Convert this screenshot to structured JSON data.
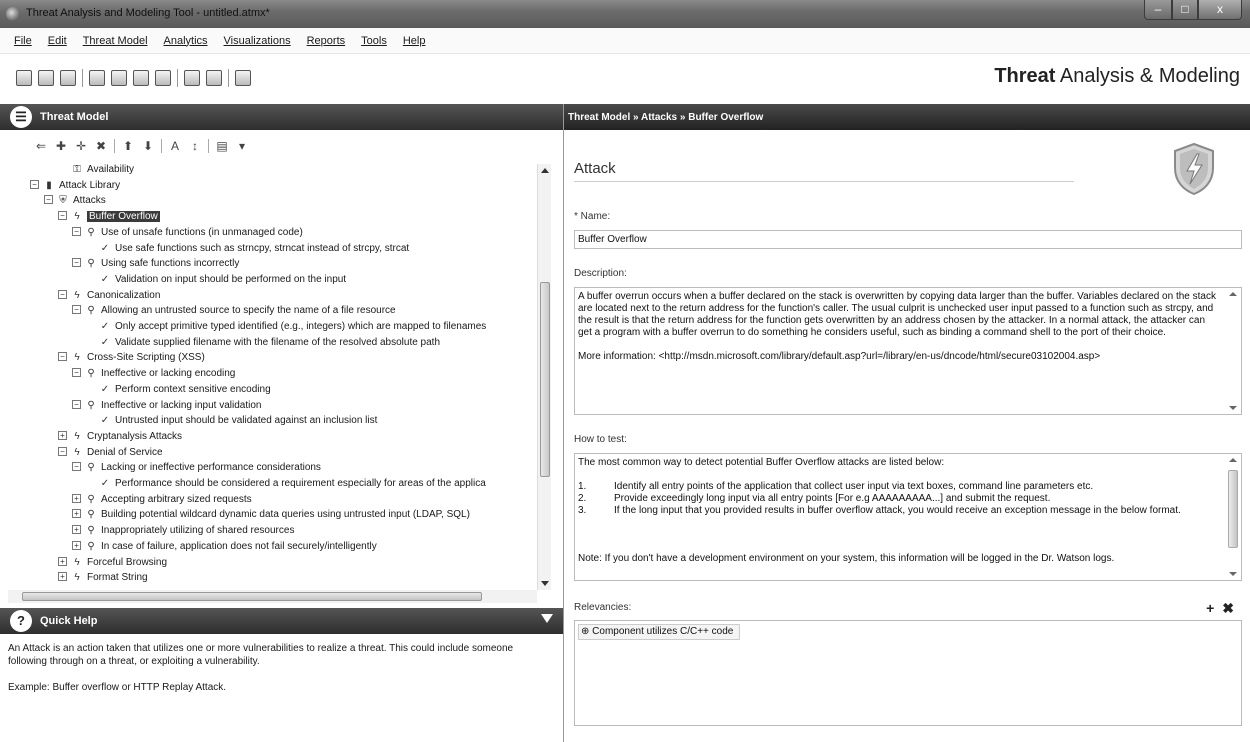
{
  "window": {
    "title": "Threat Analysis and Modeling Tool - untitled.atmx*",
    "controls": [
      "–",
      "□",
      "x"
    ]
  },
  "menu": [
    "File",
    "Edit",
    "Threat Model",
    "Analytics",
    "Visualizations",
    "Reports",
    "Tools",
    "Help"
  ],
  "brand": {
    "bold": "Threat",
    "rest": " Analysis & Modeling"
  },
  "left": {
    "header": "Threat Model",
    "tree": [
      {
        "label": "Availability",
        "icon": "key",
        "expander": ""
      },
      {
        "label": "Attack Library",
        "icon": "book",
        "expander": "−"
      },
      {
        "label": "Attacks",
        "icon": "shield",
        "expander": "−"
      },
      {
        "label": "Buffer Overflow",
        "icon": "bolt",
        "expander": "−"
      },
      {
        "label": "Use of unsafe functions (in unmanaged code)",
        "icon": "magnify",
        "expander": "−"
      },
      {
        "label": "Use safe functions such as strncpy, strncat instead of strcpy, strcat",
        "icon": "check",
        "expander": ""
      },
      {
        "label": "Using safe functions incorrectly",
        "icon": "magnify",
        "expander": "−"
      },
      {
        "label": "Validation on input should be performed on the input",
        "icon": "check",
        "expander": ""
      },
      {
        "label": "Canonicalization",
        "icon": "bolt",
        "expander": "−"
      },
      {
        "label": "Allowing an untrusted source to specify the name of a file resource",
        "icon": "magnify",
        "expander": "−"
      },
      {
        "label": "Only accept primitive typed identified (e.g., integers) which are mapped to filenames",
        "icon": "check",
        "expander": ""
      },
      {
        "label": "Validate supplied filename with the filename of the resolved absolute path",
        "icon": "check",
        "expander": ""
      },
      {
        "label": "Cross-Site Scripting (XSS)",
        "icon": "bolt",
        "expander": "−"
      },
      {
        "label": "Ineffective or lacking encoding",
        "icon": "magnify",
        "expander": "−"
      },
      {
        "label": "Perform context sensitive encoding",
        "icon": "check",
        "expander": ""
      },
      {
        "label": "Ineffective or lacking input validation",
        "icon": "magnify",
        "expander": "−"
      },
      {
        "label": "Untrusted input should be validated against an inclusion list",
        "icon": "check",
        "expander": ""
      },
      {
        "label": "Cryptanalysis Attacks",
        "icon": "bolt",
        "expander": "+"
      },
      {
        "label": "Denial of Service",
        "icon": "bolt",
        "expander": "−"
      },
      {
        "label": "Lacking or ineffective performance considerations",
        "icon": "magnify",
        "expander": "−"
      },
      {
        "label": "Performance should be considered a requirement especially for areas of the applica",
        "icon": "check",
        "expander": ""
      },
      {
        "label": "Accepting arbitrary sized requests",
        "icon": "magnify",
        "expander": "+"
      },
      {
        "label": "Building potential wildcard dynamic data queries using untrusted input (LDAP, SQL)",
        "icon": "magnify",
        "expander": "+"
      },
      {
        "label": "Inappropriately utilizing of shared resources",
        "icon": "magnify",
        "expander": "+"
      },
      {
        "label": "In case of failure, application does not fail securely/intelligently",
        "icon": "magnify",
        "expander": "+"
      },
      {
        "label": "Forceful Browsing",
        "icon": "bolt",
        "expander": "+"
      },
      {
        "label": "Format String",
        "icon": "bolt",
        "expander": "+"
      }
    ],
    "selected_index": 3,
    "quick_help": {
      "title": "Quick Help",
      "text1": "An Attack is an action taken that utilizes one or more vulnerabilities to realize a threat. This could include someone following through on a threat, or exploiting a vulnerability.",
      "text2": "Example: Buffer overflow or HTTP Replay Attack."
    }
  },
  "right": {
    "breadcrumb": "Threat Model » Attacks » Buffer Overflow",
    "heading": "Attack",
    "name_label": "* Name:",
    "name_value": "Buffer Overflow",
    "description_label": "Description:",
    "description": "A buffer overrun occurs when a buffer declared on the stack is overwritten by copying data larger than the buffer. Variables declared on the stack are located next to the return address for the function's caller. The usual culprit is unchecked user input passed to a function such as strcpy, and the result is that the return address for the function gets overwritten by an address chosen by the attacker. In a normal attack, the attacker can get a program with a buffer overrun to do something he considers useful, such as binding a command shell to the port of their choice.",
    "more_info": "More information: <http://msdn.microsoft.com/library/default.asp?url=/library/en-us/dncode/html/secure03102004.asp>",
    "howto_label": "How to test:",
    "howto_intro": "The most common way to detect potential Buffer Overflow attacks are listed below:",
    "steps": [
      {
        "num": "1.",
        "text": "Identify all entry points of the application that collect user input via text boxes, command line parameters etc."
      },
      {
        "num": "2.",
        "text": "Provide exceedingly long input via all entry points [For e.g AAAAAAAAA...] and submit the request."
      },
      {
        "num": "3.",
        "text": "If the long input that you provided results in buffer overflow attack, you would receive an exception message in the below format."
      }
    ],
    "howto_note": "Note: If you don't have a development environment on your system, this information will be logged in the Dr. Watson logs.",
    "relevancies_label": "Relevancies:",
    "relevancies": [
      "Component utilizes C/C++ code"
    ],
    "rel_add": "+",
    "rel_remove": "✖"
  }
}
